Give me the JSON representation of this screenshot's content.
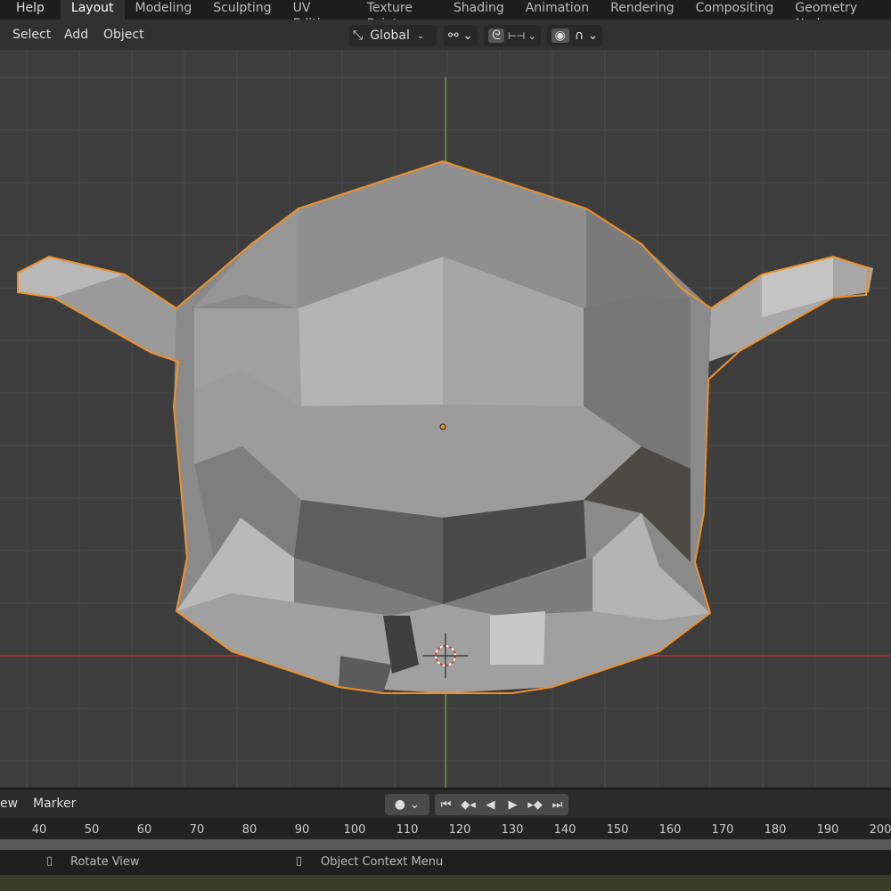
{
  "topbar": {
    "help": "Help",
    "workspaces": [
      "Layout",
      "Modeling",
      "Sculpting",
      "UV Editing",
      "Texture Paint",
      "Shading",
      "Animation",
      "Rendering",
      "Compositing",
      "Geometry Nodes"
    ],
    "active": "Layout"
  },
  "header": {
    "menus": [
      "Select",
      "Add",
      "Object"
    ],
    "orientation": "Global"
  },
  "timeline": {
    "menus": [
      "ew",
      "Marker"
    ],
    "frames": [
      "40",
      "50",
      "60",
      "70",
      "80",
      "90",
      "100",
      "110",
      "120",
      "130",
      "140",
      "150",
      "160",
      "170",
      "180",
      "190",
      "200"
    ]
  },
  "status": {
    "left": "Rotate View",
    "right": "Object Context Menu"
  },
  "colors": {
    "selection": "#f0902a",
    "x_axis": "#b03040",
    "y_axis": "#6a9a28"
  }
}
